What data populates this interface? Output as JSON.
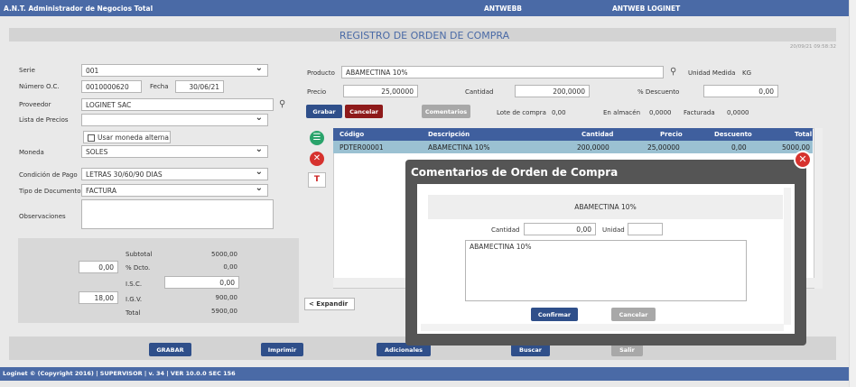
{
  "topbar": {
    "app_title": "A.N.T. Administrador de Negocios Total",
    "server": "ANTWEBB",
    "company": "ANTWEB LOGINET"
  },
  "page": {
    "title": "REGISTRO DE ORDEN DE COMPRA",
    "timestamp": "20/09/21 09:58:32"
  },
  "form": {
    "serie_label": "Serie",
    "serie_value": "001",
    "numero_label": "Número O.C.",
    "numero_value": "0010000620",
    "fecha_label": "Fecha",
    "fecha_value": "30/06/21",
    "proveedor_label": "Proveedor",
    "proveedor_value": "LOGINET SAC",
    "lista_label": "Lista de Precios",
    "lista_value": "",
    "moneda_alterna_label": "Usar moneda alterna",
    "moneda_label": "Moneda",
    "moneda_value": "SOLES",
    "condicion_label": "Condición de Pago",
    "condicion_value": "LETRAS 30/60/90 DIAS",
    "tipo_doc_label": "Tipo de Documento",
    "tipo_doc_value": "FACTURA",
    "obs_label": "Observaciones",
    "obs_value": ""
  },
  "totals": {
    "subtotal_label": "Subtotal",
    "subtotal_value": "5000,00",
    "dcto_pct": "0,00",
    "dcto_label": "% Dcto.",
    "dcto_value": "0,00",
    "isc_label": "I.S.C.",
    "isc_value": "0,00",
    "igv_pct": "18,00",
    "igv_label": "I.G.V.",
    "igv_value": "900,00",
    "total_label": "Total",
    "total_value": "5900,00"
  },
  "product": {
    "producto_label": "Producto",
    "producto_value": "ABAMECTINA 10%",
    "unidad_label": "Unidad Medida",
    "unidad_value": "KG",
    "precio_label": "Precio",
    "precio_value": "25,00000",
    "cantidad_label": "Cantidad",
    "cantidad_value": "200,0000",
    "descuento_label": "% Descuento",
    "descuento_value": "0,00",
    "grabar": "Grabar",
    "cancelar": "Cancelar",
    "comentarios": "Comentarios",
    "lote_label": "Lote de compra",
    "lote_value": "0,00",
    "almacen_label": "En almacén",
    "almacen_value": "0,0000",
    "facturada_label": "Facturada",
    "facturada_value": "0,0000"
  },
  "grid": {
    "headers": [
      "Código",
      "Descripción",
      "Cantidad",
      "Precio",
      "Descuento",
      "Total"
    ],
    "row": [
      "PDTER00001",
      "ABAMECTINA 10%",
      "200,0000",
      "25,00000",
      "0,00",
      "5000,00"
    ]
  },
  "side_icons": {
    "t_label": "T"
  },
  "expandir": "< Expandir",
  "modal": {
    "title": "Comentarios de Orden de Compra",
    "product": "ABAMECTINA 10%",
    "cantidad_label": "Cantidad",
    "cantidad_value": "0,00",
    "unidad_label": "Unidad",
    "unidad_value": "",
    "comment": "ABAMECTINA 10%",
    "confirmar": "Confirmar",
    "cancelar": "Cancelar"
  },
  "bottom": {
    "grabar": "GRABAR",
    "imprimir": "Imprimir",
    "adicionales": "Adicionales",
    "buscar": "Buscar",
    "salir": "Salir"
  },
  "footer": {
    "text": "Loginet © (Copyright 2016) | SUPERVISOR | v. 34 | VER 10.0.0 SEC 156"
  },
  "colors": {
    "brand": "#4a6aa6",
    "grid_header": "#3f5f9e",
    "grid_selected": "#9bc1d2",
    "danger": "#d6322e",
    "success": "#2aa36b"
  }
}
